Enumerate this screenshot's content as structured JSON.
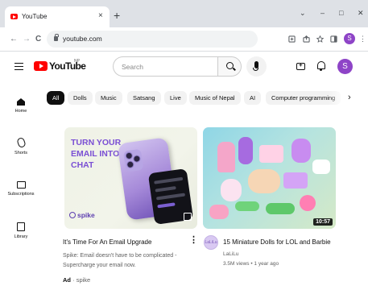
{
  "browser": {
    "tab_title": "YouTube",
    "tab_close": "×",
    "new_tab": "+",
    "url": "youtube.com",
    "profile_initial": "S",
    "window_controls": [
      "⌄",
      "–",
      "□",
      "✕"
    ],
    "nav": {
      "back": "←",
      "forward": "→",
      "reload": "C"
    }
  },
  "youtube": {
    "logo_text": "YouTube",
    "logo_region": "NP",
    "search_placeholder": "Search",
    "avatar_initial": "S"
  },
  "guide": {
    "items": [
      {
        "label": "Home",
        "icon": "home-icon"
      },
      {
        "label": "Shorts",
        "icon": "shorts-icon"
      },
      {
        "label": "Subscriptions",
        "icon": "subscriptions-icon"
      },
      {
        "label": "Library",
        "icon": "library-icon"
      }
    ]
  },
  "chips": [
    "All",
    "Dolls",
    "Music",
    "Satsang",
    "Live",
    "Music of Nepal",
    "AI",
    "Computer programming"
  ],
  "chip_next": "›",
  "videos": [
    {
      "title": "It's Time For An Email Upgrade",
      "description_line1": "Spike: Email doesn't have to be complicated -",
      "description_line2": "Supercharge your email now.",
      "ad_label": "Ad",
      "advertiser": "spike",
      "thumb_headline": "TURN YOUR EMAIL INTO CHAT",
      "thumb_brand": "spike"
    },
    {
      "title": "15 Miniature Dolls for LOL and Barbie",
      "channel": "LaLiLu",
      "stats": "3.5M views • 1 year ago",
      "duration": "10:57",
      "channel_avatar_text": "LaLiLu"
    }
  ],
  "colors": {
    "youtube_red": "#ff0000",
    "chip_active": "#0f0f0f",
    "avatar": "#8e44c7",
    "spike_purple": "#7a4fd4"
  }
}
